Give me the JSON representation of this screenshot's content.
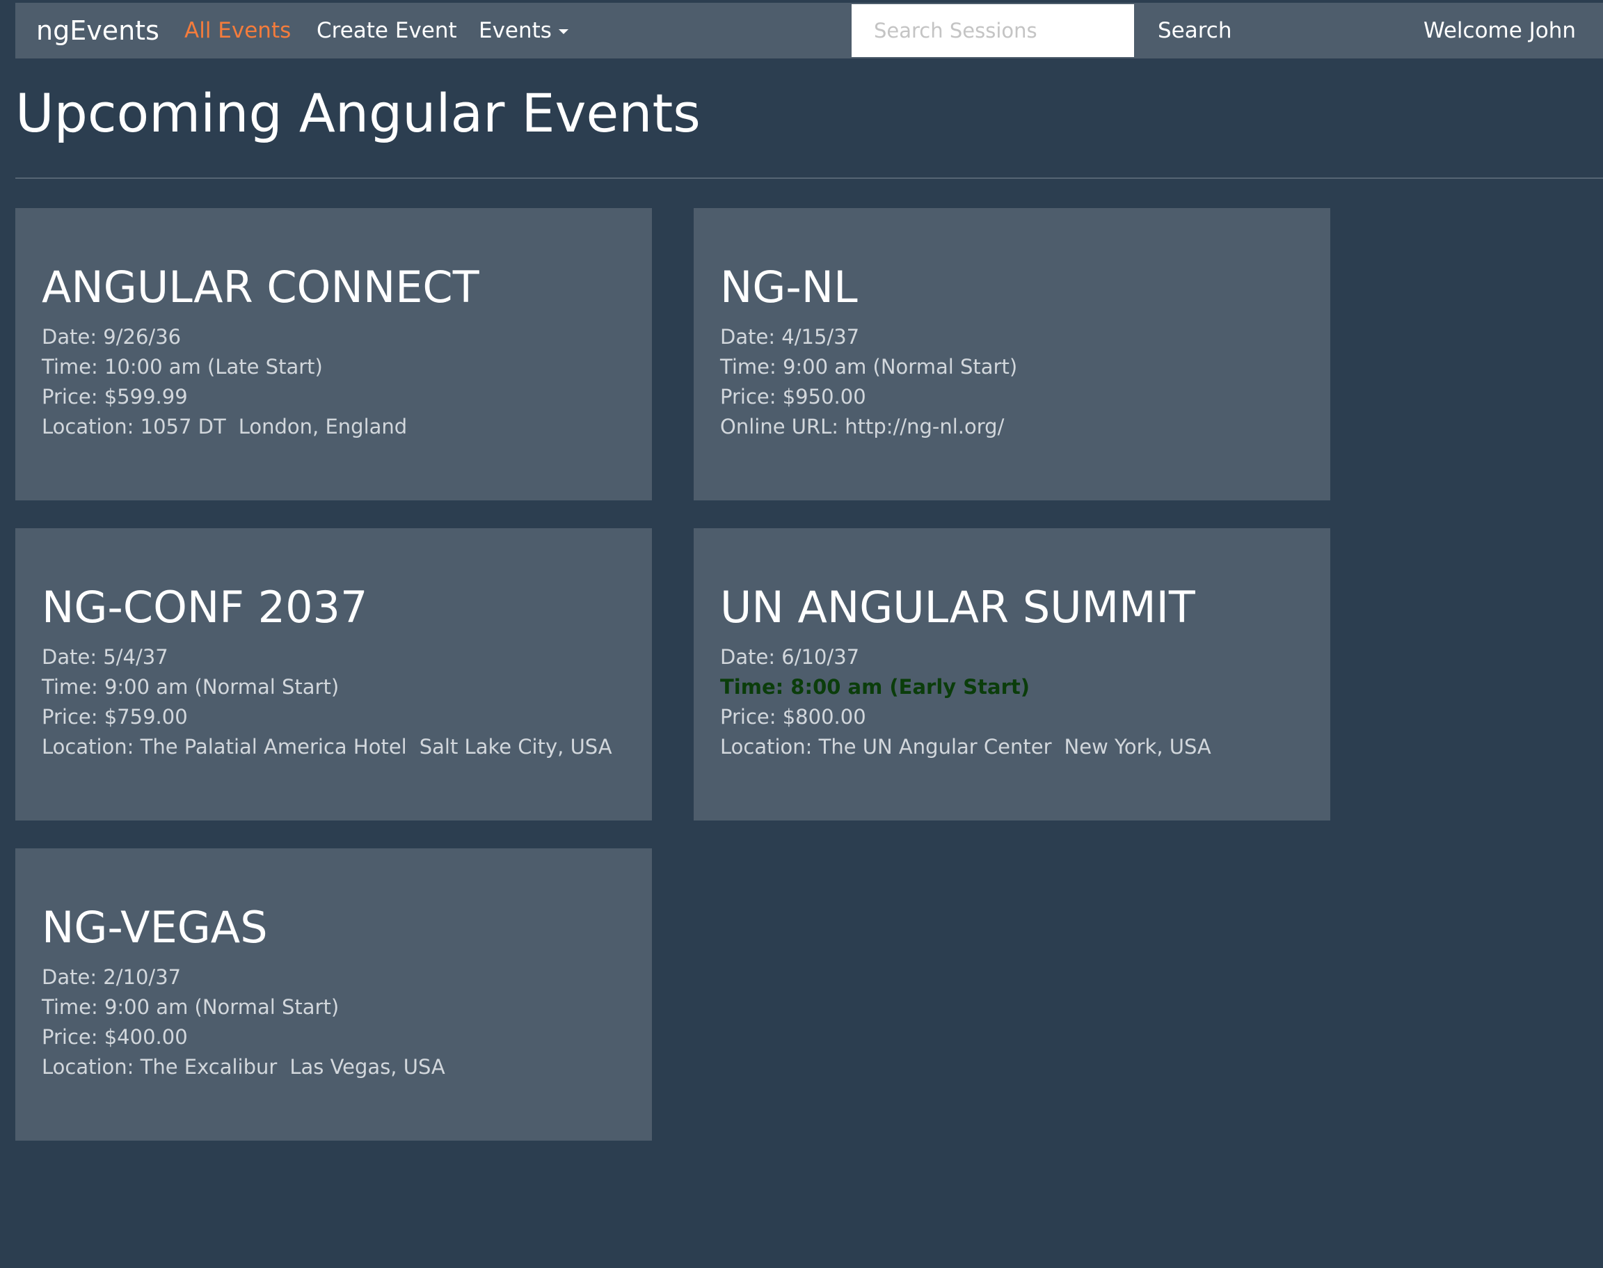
{
  "navbar": {
    "brand": "ngEvents",
    "links": {
      "all_events": "All Events",
      "create_event": "Create Event",
      "events_dropdown": "Events"
    },
    "search": {
      "placeholder": "Search Sessions",
      "button_label": "Search"
    },
    "welcome": "Welcome John"
  },
  "colors": {
    "background": "#2c3e50",
    "panel": "#4e5d6c",
    "active_link": "#f47c3c",
    "early_start": "#0b3d0b"
  },
  "page": {
    "title": "Upcoming Angular Events"
  },
  "events": [
    {
      "name": "ANGULAR CONNECT",
      "date": "Date: 9/26/36",
      "time": "Time: 10:00 am (Late Start)",
      "price": "Price: $599.99",
      "location_label": "Location: 1057 DT",
      "location_city": "London, England"
    },
    {
      "name": "NG-NL",
      "date": "Date: 4/15/37",
      "time": "Time: 9:00 am (Normal Start)",
      "price": "Price: $950.00",
      "online_url": "Online URL: http://ng-nl.org/"
    },
    {
      "name": "NG-CONF 2037",
      "date": "Date: 5/4/37",
      "time": "Time: 9:00 am (Normal Start)",
      "price": "Price: $759.00",
      "location_label": "Location: The Palatial America Hotel",
      "location_city": "Salt Lake City, USA"
    },
    {
      "name": "UN ANGULAR SUMMIT",
      "date": "Date: 6/10/37",
      "time": "Time: 8:00 am (Early Start)",
      "price": "Price: $800.00",
      "location_label": "Location: The UN Angular Center",
      "location_city": "New York, USA"
    },
    {
      "name": "NG-VEGAS",
      "date": "Date: 2/10/37",
      "time": "Time: 9:00 am (Normal Start)",
      "price": "Price: $400.00",
      "location_label": "Location: The Excalibur",
      "location_city": "Las Vegas, USA"
    }
  ]
}
